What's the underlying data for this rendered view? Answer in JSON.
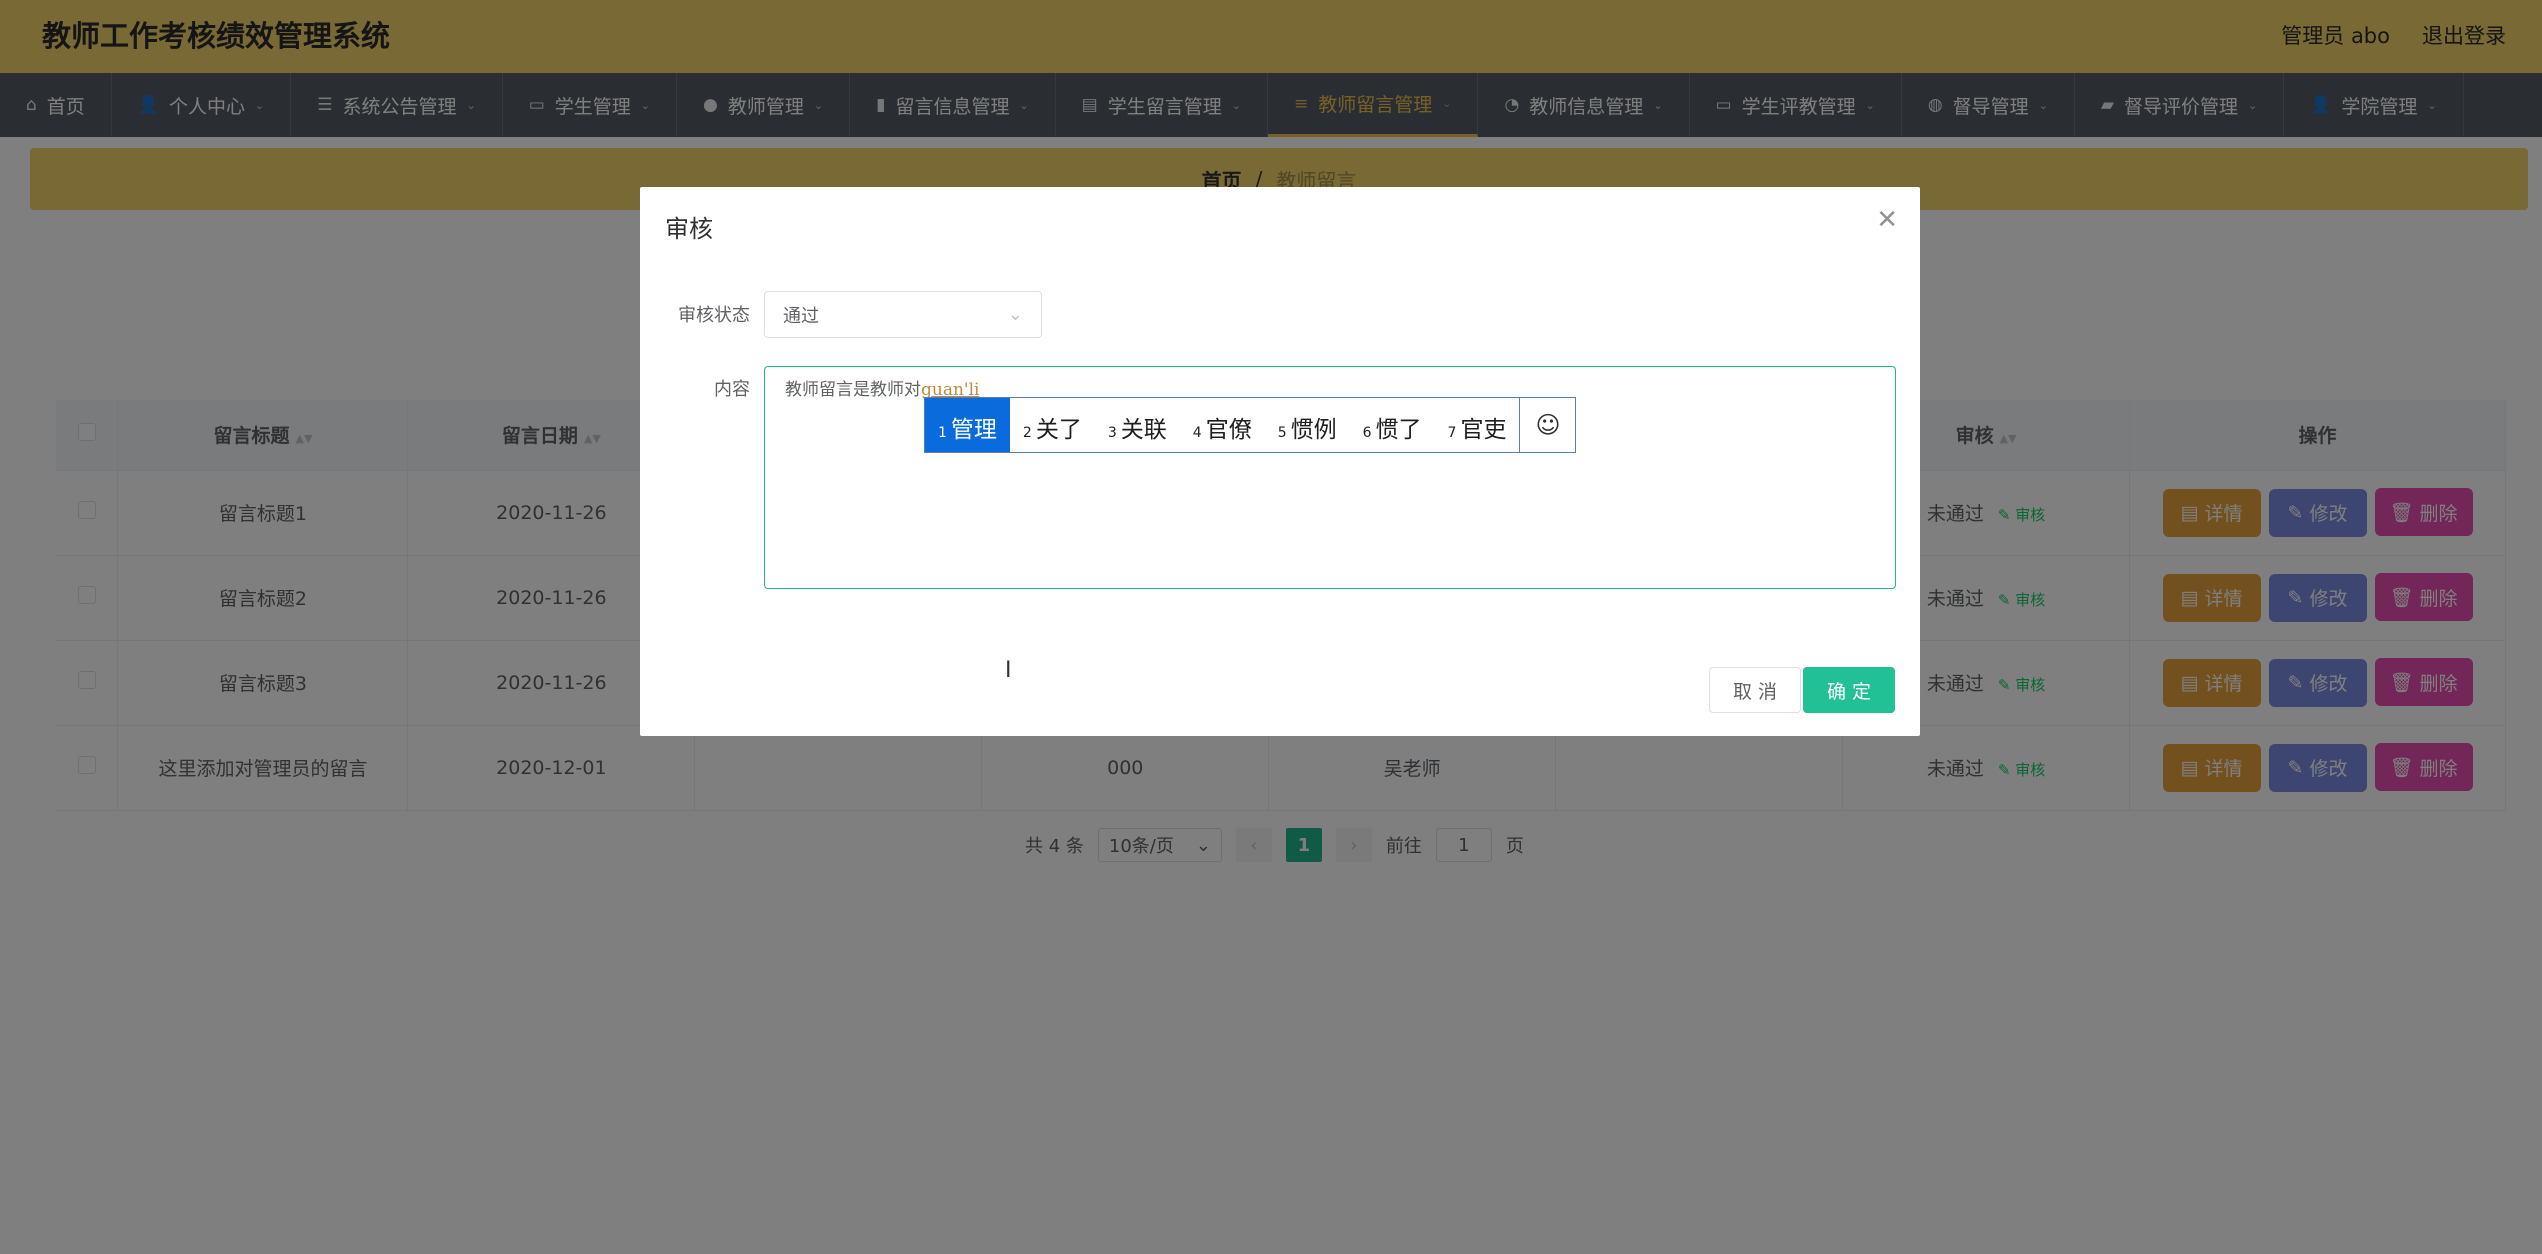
{
  "header": {
    "title": "教师工作考核绩效管理系统",
    "user_label": "管理员 abo",
    "logout_label": "退出登录"
  },
  "nav": {
    "items": [
      {
        "label": "首页",
        "icon": "home-icon",
        "glyph": "⌂",
        "caret": false
      },
      {
        "label": "个人中心",
        "icon": "user-icon",
        "glyph": "👤",
        "caret": true
      },
      {
        "label": "系统公告管理",
        "icon": "settings-icon",
        "glyph": "☰",
        "caret": true
      },
      {
        "label": "学生管理",
        "icon": "chat-icon",
        "glyph": "▭",
        "caret": true
      },
      {
        "label": "教师管理",
        "icon": "location-icon",
        "glyph": "●",
        "caret": true
      },
      {
        "label": "留言信息管理",
        "icon": "chart-icon",
        "glyph": "▮",
        "caret": true
      },
      {
        "label": "学生留言管理",
        "icon": "document-icon",
        "glyph": "▤",
        "caret": true
      },
      {
        "label": "教师留言管理",
        "icon": "menu-icon",
        "glyph": "≡",
        "caret": true,
        "active": true
      },
      {
        "label": "教师信息管理",
        "icon": "power-icon",
        "glyph": "◔",
        "caret": true
      },
      {
        "label": "学生评教管理",
        "icon": "monitor-icon",
        "glyph": "▭",
        "caret": true
      },
      {
        "label": "督导管理",
        "icon": "globe-icon",
        "glyph": "◍",
        "caret": true
      },
      {
        "label": "督导评价管理",
        "icon": "briefcase-icon",
        "glyph": "▰",
        "caret": true
      },
      {
        "label": "学院管理",
        "icon": "user-icon",
        "glyph": "👤",
        "caret": true
      }
    ]
  },
  "breadcrumb": {
    "home": "首页",
    "separator": "/",
    "current": "教师留言"
  },
  "table": {
    "headers": [
      "留言标题",
      "留言日期",
      "",
      "",
      "",
      "",
      "审核",
      "操作"
    ],
    "rows": [
      {
        "title": "留言标题1",
        "date": "2020-11-26",
        "c3": "",
        "c4": "",
        "c5": "",
        "c6": "",
        "status": "未通过",
        "audit": "审核"
      },
      {
        "title": "留言标题2",
        "date": "2020-11-26",
        "c3": "",
        "c4": "",
        "c5": "",
        "c6": "",
        "status": "未通过",
        "audit": "审核"
      },
      {
        "title": "留言标题3",
        "date": "2020-11-26",
        "c3": "",
        "c4": "",
        "c5": "",
        "c6": "",
        "status": "未通过",
        "audit": "审核"
      },
      {
        "title": "这里添加对管理员的留言",
        "date": "2020-12-01",
        "c3": "",
        "c4": "000",
        "c5": "吴老师",
        "c6": "",
        "status": "未通过",
        "audit": "审核"
      }
    ],
    "actions": {
      "detail": "详情",
      "edit": "修改",
      "delete": "删除"
    }
  },
  "pagination": {
    "total": "共 4 条",
    "page_size": "10条/页",
    "current_page": "1",
    "goto_label": "前往",
    "goto_value": "1",
    "page_unit": "页"
  },
  "dialog": {
    "title": "审核",
    "status_label": "审核状态",
    "status_value": "通过",
    "content_label": "内容",
    "content_text": "教师留言是教师对",
    "content_composing": "guan'li",
    "cancel": "取 消",
    "confirm": "确 定"
  },
  "ime": {
    "candidates": [
      {
        "num": "1",
        "text": "管理"
      },
      {
        "num": "2",
        "text": "关了"
      },
      {
        "num": "3",
        "text": "关联"
      },
      {
        "num": "4",
        "text": "官僚"
      },
      {
        "num": "5",
        "text": "惯例"
      },
      {
        "num": "6",
        "text": "惯了"
      },
      {
        "num": "7",
        "text": "官吏"
      }
    ],
    "emoji": "☺"
  }
}
